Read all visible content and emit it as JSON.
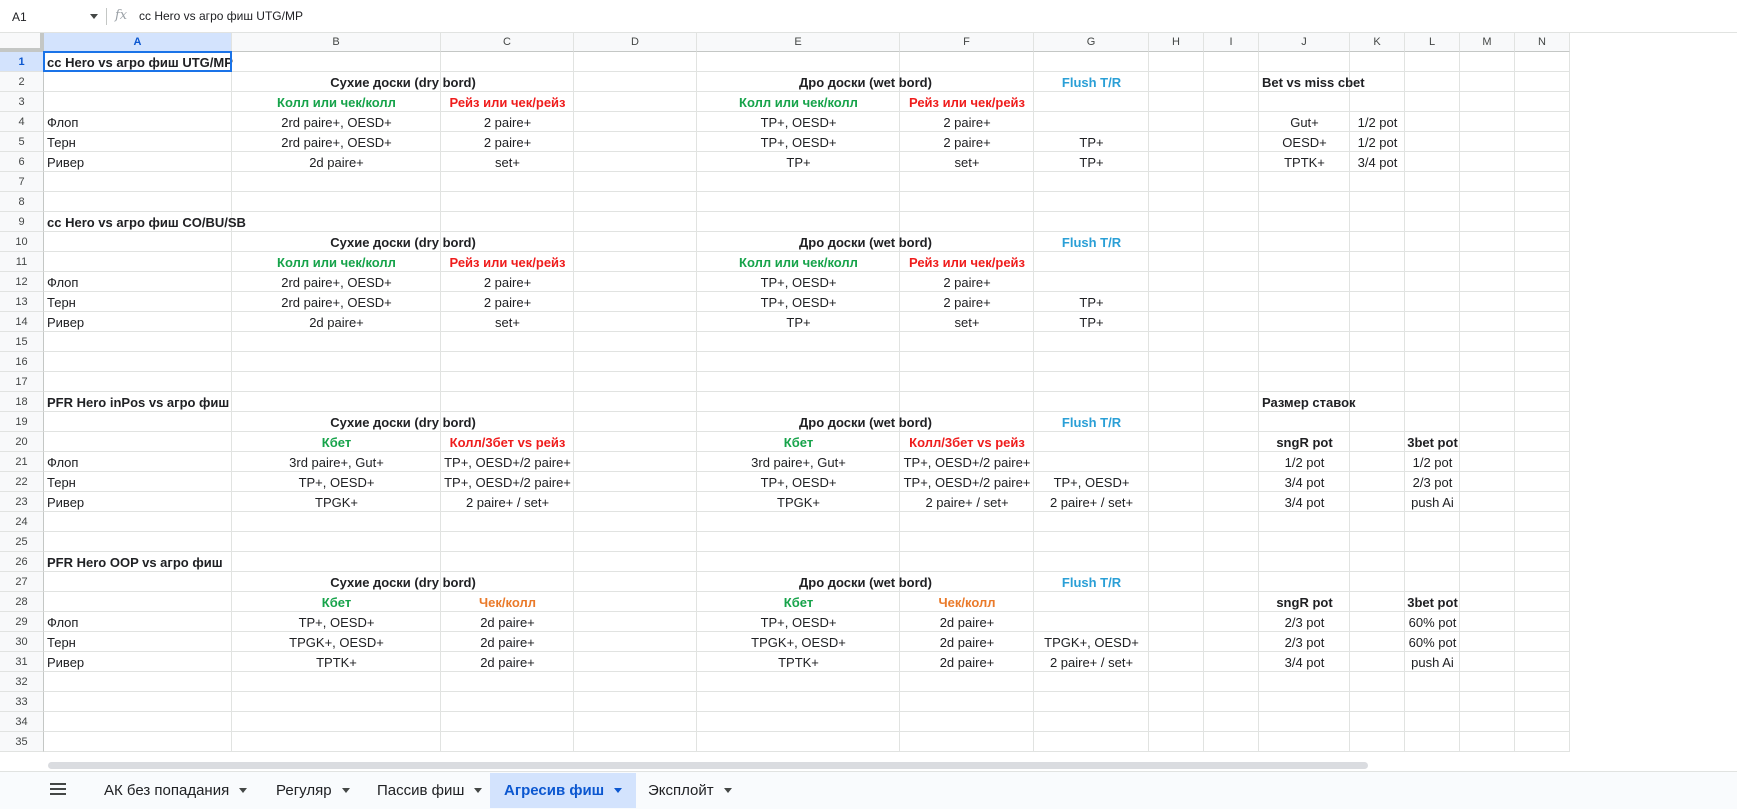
{
  "formula_bar": {
    "name_box": "A1",
    "fx_icon": "fx-icon",
    "formula": "cc Hero vs агро фиш UTG/MP"
  },
  "columns": [
    "A",
    "B",
    "C",
    "D",
    "E",
    "F",
    "G",
    "H",
    "I",
    "J",
    "K",
    "L",
    "M",
    "N"
  ],
  "selected": {
    "col": "A",
    "row": 1
  },
  "rows_count": 35,
  "colors": {
    "green": "#16a34a",
    "red": "#ef1c1c",
    "blue": "#2a9fd6",
    "orange": "#ea7a2a",
    "selection": "#1a73e8",
    "active_tab": "#d3e3fd"
  },
  "cells": [
    {
      "r": 1,
      "c": "A",
      "v": "cc Hero vs агро фиш UTG/MP",
      "s": "b",
      "a": "l"
    },
    {
      "r": 2,
      "c": "B",
      "v": "Сухие доски (dry bord)",
      "s": "b",
      "a": "c",
      "span": "BC"
    },
    {
      "r": 2,
      "c": "E",
      "v": "Дро доски (wet bord)",
      "s": "b",
      "a": "c",
      "span": "EF"
    },
    {
      "r": 2,
      "c": "G",
      "v": "Flush T/R",
      "s": "blue",
      "a": "c"
    },
    {
      "r": 2,
      "c": "J",
      "v": "Bet vs miss cbet",
      "s": "b",
      "a": "l"
    },
    {
      "r": 3,
      "c": "B",
      "v": "Колл или чек/колл",
      "s": "green",
      "a": "c"
    },
    {
      "r": 3,
      "c": "C",
      "v": "Рейз или чек/рейз",
      "s": "red",
      "a": "c"
    },
    {
      "r": 3,
      "c": "E",
      "v": "Колл или чек/колл",
      "s": "green",
      "a": "c"
    },
    {
      "r": 3,
      "c": "F",
      "v": "Рейз или чек/рейз",
      "s": "red",
      "a": "c"
    },
    {
      "r": 4,
      "c": "A",
      "v": "Флоп",
      "a": "l"
    },
    {
      "r": 4,
      "c": "B",
      "v": "2rd paire+, OESD+",
      "a": "c"
    },
    {
      "r": 4,
      "c": "C",
      "v": "2 paire+",
      "a": "c"
    },
    {
      "r": 4,
      "c": "E",
      "v": "TP+, OESD+",
      "a": "c"
    },
    {
      "r": 4,
      "c": "F",
      "v": "2 paire+",
      "a": "c"
    },
    {
      "r": 4,
      "c": "J",
      "v": "Gut+",
      "a": "c"
    },
    {
      "r": 4,
      "c": "K",
      "v": "1/2 pot",
      "a": "c"
    },
    {
      "r": 5,
      "c": "A",
      "v": "Терн",
      "a": "l"
    },
    {
      "r": 5,
      "c": "B",
      "v": "2rd paire+, OESD+",
      "a": "c"
    },
    {
      "r": 5,
      "c": "C",
      "v": "2 paire+",
      "a": "c"
    },
    {
      "r": 5,
      "c": "E",
      "v": "TP+, OESD+",
      "a": "c"
    },
    {
      "r": 5,
      "c": "F",
      "v": "2 paire+",
      "a": "c"
    },
    {
      "r": 5,
      "c": "G",
      "v": "TP+",
      "a": "c"
    },
    {
      "r": 5,
      "c": "J",
      "v": "OESD+",
      "a": "c"
    },
    {
      "r": 5,
      "c": "K",
      "v": "1/2 pot",
      "a": "c"
    },
    {
      "r": 6,
      "c": "A",
      "v": "Ривер",
      "a": "l"
    },
    {
      "r": 6,
      "c": "B",
      "v": "2d paire+",
      "a": "c"
    },
    {
      "r": 6,
      "c": "C",
      "v": "set+",
      "a": "c"
    },
    {
      "r": 6,
      "c": "E",
      "v": "TP+",
      "a": "c"
    },
    {
      "r": 6,
      "c": "F",
      "v": "set+",
      "a": "c"
    },
    {
      "r": 6,
      "c": "G",
      "v": "TP+",
      "a": "c"
    },
    {
      "r": 6,
      "c": "J",
      "v": "TPTK+",
      "a": "c"
    },
    {
      "r": 6,
      "c": "K",
      "v": "3/4 pot",
      "a": "c"
    },
    {
      "r": 9,
      "c": "A",
      "v": "cc Hero vs агро фиш CO/BU/SB",
      "s": "b",
      "a": "l"
    },
    {
      "r": 10,
      "c": "B",
      "v": "Сухие доски (dry bord)",
      "s": "b",
      "a": "c",
      "span": "BC"
    },
    {
      "r": 10,
      "c": "E",
      "v": "Дро доски (wet bord)",
      "s": "b",
      "a": "c",
      "span": "EF"
    },
    {
      "r": 10,
      "c": "G",
      "v": "Flush T/R",
      "s": "blue",
      "a": "c"
    },
    {
      "r": 11,
      "c": "B",
      "v": "Колл или чек/колл",
      "s": "green",
      "a": "c"
    },
    {
      "r": 11,
      "c": "C",
      "v": "Рейз или чек/рейз",
      "s": "red",
      "a": "c"
    },
    {
      "r": 11,
      "c": "E",
      "v": "Колл или чек/колл",
      "s": "green",
      "a": "c"
    },
    {
      "r": 11,
      "c": "F",
      "v": "Рейз или чек/рейз",
      "s": "red",
      "a": "c"
    },
    {
      "r": 12,
      "c": "A",
      "v": "Флоп",
      "a": "l"
    },
    {
      "r": 12,
      "c": "B",
      "v": "2rd paire+, OESD+",
      "a": "c"
    },
    {
      "r": 12,
      "c": "C",
      "v": "2 paire+",
      "a": "c"
    },
    {
      "r": 12,
      "c": "E",
      "v": "TP+, OESD+",
      "a": "c"
    },
    {
      "r": 12,
      "c": "F",
      "v": "2 paire+",
      "a": "c"
    },
    {
      "r": 13,
      "c": "A",
      "v": "Терн",
      "a": "l"
    },
    {
      "r": 13,
      "c": "B",
      "v": "2rd paire+, OESD+",
      "a": "c"
    },
    {
      "r": 13,
      "c": "C",
      "v": "2 paire+",
      "a": "c"
    },
    {
      "r": 13,
      "c": "E",
      "v": "TP+, OESD+",
      "a": "c"
    },
    {
      "r": 13,
      "c": "F",
      "v": "2 paire+",
      "a": "c"
    },
    {
      "r": 13,
      "c": "G",
      "v": "TP+",
      "a": "c"
    },
    {
      "r": 14,
      "c": "A",
      "v": "Ривер",
      "a": "l"
    },
    {
      "r": 14,
      "c": "B",
      "v": "2d paire+",
      "a": "c"
    },
    {
      "r": 14,
      "c": "C",
      "v": "set+",
      "a": "c"
    },
    {
      "r": 14,
      "c": "E",
      "v": "TP+",
      "a": "c"
    },
    {
      "r": 14,
      "c": "F",
      "v": "set+",
      "a": "c"
    },
    {
      "r": 14,
      "c": "G",
      "v": "TP+",
      "a": "c"
    },
    {
      "r": 18,
      "c": "A",
      "v": "PFR Hero inPos vs  агро фиш",
      "s": "b",
      "a": "l"
    },
    {
      "r": 18,
      "c": "J",
      "v": "Размер ставок",
      "s": "b",
      "a": "l"
    },
    {
      "r": 19,
      "c": "B",
      "v": "Сухие доски (dry bord)",
      "s": "b",
      "a": "c",
      "span": "BC"
    },
    {
      "r": 19,
      "c": "E",
      "v": "Дро доски (wet bord)",
      "s": "b",
      "a": "c",
      "span": "EF"
    },
    {
      "r": 19,
      "c": "G",
      "v": "Flush T/R",
      "s": "blue",
      "a": "c"
    },
    {
      "r": 20,
      "c": "B",
      "v": "Кбет",
      "s": "green",
      "a": "c"
    },
    {
      "r": 20,
      "c": "C",
      "v": "Колл/3бет vs рейз",
      "s": "red",
      "a": "c"
    },
    {
      "r": 20,
      "c": "E",
      "v": "Кбет",
      "s": "green",
      "a": "c"
    },
    {
      "r": 20,
      "c": "F",
      "v": "Колл/3бет vs рейз",
      "s": "red",
      "a": "c"
    },
    {
      "r": 20,
      "c": "J",
      "v": "sngR pot",
      "s": "b",
      "a": "c"
    },
    {
      "r": 20,
      "c": "L",
      "v": "3bet pot",
      "s": "b",
      "a": "c"
    },
    {
      "r": 21,
      "c": "A",
      "v": "Флоп",
      "a": "l"
    },
    {
      "r": 21,
      "c": "B",
      "v": "3rd paire+, Gut+",
      "a": "c"
    },
    {
      "r": 21,
      "c": "C",
      "v": "TP+, OESD+/2 paire+",
      "a": "c"
    },
    {
      "r": 21,
      "c": "E",
      "v": "3rd paire+, Gut+",
      "a": "c"
    },
    {
      "r": 21,
      "c": "F",
      "v": "TP+, OESD+/2 paire+",
      "a": "c"
    },
    {
      "r": 21,
      "c": "J",
      "v": "1/2 pot",
      "a": "c"
    },
    {
      "r": 21,
      "c": "L",
      "v": "1/2 pot",
      "a": "c"
    },
    {
      "r": 22,
      "c": "A",
      "v": "Терн",
      "a": "l"
    },
    {
      "r": 22,
      "c": "B",
      "v": "TP+, OESD+",
      "a": "c"
    },
    {
      "r": 22,
      "c": "C",
      "v": "TP+, OESD+/2 paire+",
      "a": "c"
    },
    {
      "r": 22,
      "c": "E",
      "v": "TP+, OESD+",
      "a": "c"
    },
    {
      "r": 22,
      "c": "F",
      "v": "TP+, OESD+/2 paire+",
      "a": "c"
    },
    {
      "r": 22,
      "c": "G",
      "v": "TP+, OESD+",
      "a": "c"
    },
    {
      "r": 22,
      "c": "J",
      "v": "3/4 pot",
      "a": "c"
    },
    {
      "r": 22,
      "c": "L",
      "v": "2/3 pot",
      "a": "c"
    },
    {
      "r": 23,
      "c": "A",
      "v": "Ривер",
      "a": "l"
    },
    {
      "r": 23,
      "c": "B",
      "v": "TPGK+",
      "a": "c"
    },
    {
      "r": 23,
      "c": "C",
      "v": "2 paire+ / set+",
      "a": "c"
    },
    {
      "r": 23,
      "c": "E",
      "v": "TPGK+",
      "a": "c"
    },
    {
      "r": 23,
      "c": "F",
      "v": "2 paire+ / set+",
      "a": "c"
    },
    {
      "r": 23,
      "c": "G",
      "v": "2 paire+ / set+",
      "a": "c"
    },
    {
      "r": 23,
      "c": "J",
      "v": "3/4 pot",
      "a": "c"
    },
    {
      "r": 23,
      "c": "L",
      "v": "push Ai",
      "a": "c"
    },
    {
      "r": 26,
      "c": "A",
      "v": "PFR Hero OOP vs агро фиш",
      "s": "b",
      "a": "l"
    },
    {
      "r": 27,
      "c": "B",
      "v": "Сухие доски (dry bord)",
      "s": "b",
      "a": "c",
      "span": "BC"
    },
    {
      "r": 27,
      "c": "E",
      "v": "Дро доски (wet bord)",
      "s": "b",
      "a": "c",
      "span": "EF"
    },
    {
      "r": 27,
      "c": "G",
      "v": "Flush T/R",
      "s": "blue",
      "a": "c"
    },
    {
      "r": 28,
      "c": "B",
      "v": "Кбет",
      "s": "green",
      "a": "c"
    },
    {
      "r": 28,
      "c": "C",
      "v": "Чек/колл",
      "s": "orange",
      "a": "c"
    },
    {
      "r": 28,
      "c": "E",
      "v": "Кбет",
      "s": "green",
      "a": "c"
    },
    {
      "r": 28,
      "c": "F",
      "v": "Чек/колл",
      "s": "orange",
      "a": "c"
    },
    {
      "r": 28,
      "c": "J",
      "v": "sngR pot",
      "s": "b",
      "a": "c"
    },
    {
      "r": 28,
      "c": "L",
      "v": "3bet pot",
      "s": "b",
      "a": "c"
    },
    {
      "r": 29,
      "c": "A",
      "v": "Флоп",
      "a": "l"
    },
    {
      "r": 29,
      "c": "B",
      "v": "TP+, OESD+",
      "a": "c"
    },
    {
      "r": 29,
      "c": "C",
      "v": "2d paire+",
      "a": "c"
    },
    {
      "r": 29,
      "c": "E",
      "v": "TP+, OESD+",
      "a": "c"
    },
    {
      "r": 29,
      "c": "F",
      "v": "2d paire+",
      "a": "c"
    },
    {
      "r": 29,
      "c": "J",
      "v": "2/3 pot",
      "a": "c"
    },
    {
      "r": 29,
      "c": "L",
      "v": "60% pot",
      "a": "c"
    },
    {
      "r": 30,
      "c": "A",
      "v": "Терн",
      "a": "l"
    },
    {
      "r": 30,
      "c": "B",
      "v": "TPGK+, OESD+",
      "a": "c"
    },
    {
      "r": 30,
      "c": "C",
      "v": "2d paire+",
      "a": "c"
    },
    {
      "r": 30,
      "c": "E",
      "v": "TPGK+, OESD+",
      "a": "c"
    },
    {
      "r": 30,
      "c": "F",
      "v": "2d paire+",
      "a": "c"
    },
    {
      "r": 30,
      "c": "G",
      "v": "TPGK+, OESD+",
      "a": "c"
    },
    {
      "r": 30,
      "c": "J",
      "v": "2/3 pot",
      "a": "c"
    },
    {
      "r": 30,
      "c": "L",
      "v": "60% pot",
      "a": "c"
    },
    {
      "r": 31,
      "c": "A",
      "v": "Ривер",
      "a": "l"
    },
    {
      "r": 31,
      "c": "B",
      "v": "TPTK+",
      "a": "c"
    },
    {
      "r": 31,
      "c": "C",
      "v": "2d paire+",
      "a": "c"
    },
    {
      "r": 31,
      "c": "E",
      "v": "TPTK+",
      "a": "c"
    },
    {
      "r": 31,
      "c": "F",
      "v": "2d paire+",
      "a": "c"
    },
    {
      "r": 31,
      "c": "G",
      "v": "2 paire+ / set+",
      "a": "c"
    },
    {
      "r": 31,
      "c": "J",
      "v": "3/4 pot",
      "a": "c"
    },
    {
      "r": 31,
      "c": "L",
      "v": "push Ai",
      "a": "c"
    }
  ],
  "sheet_tabs": {
    "all_sheets_icon": "menu-icon",
    "tabs": [
      {
        "label": "АК без попадания",
        "active": false
      },
      {
        "label": "Регуляр",
        "active": false
      },
      {
        "label": "Пассив фиш",
        "active": false
      },
      {
        "label": "Агресив фиш",
        "active": true
      },
      {
        "label": "Эксплойт",
        "active": false
      }
    ]
  }
}
